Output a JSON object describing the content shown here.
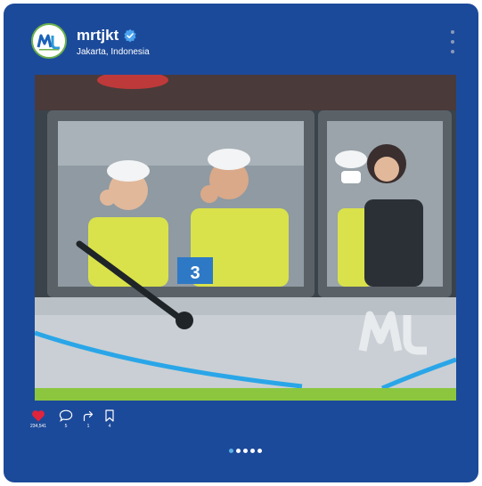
{
  "post": {
    "username": "mrtjkt",
    "location": "Jakarta, Indonesia",
    "verified": true,
    "avatar_logo": "mrt-jakarta-logo",
    "train_number": "3",
    "photo_logo": "mrt-jakarta-logo"
  },
  "actions": {
    "likes": "234,541",
    "comments": "5",
    "shares": "1",
    "saves": "4"
  },
  "carousel": {
    "total": 5,
    "active_index": 0
  },
  "colors": {
    "card": "#1c4a9a",
    "accent_green": "#8cc63f",
    "like_red": "#e0243c",
    "verified_blue": "#4aa3f0"
  }
}
